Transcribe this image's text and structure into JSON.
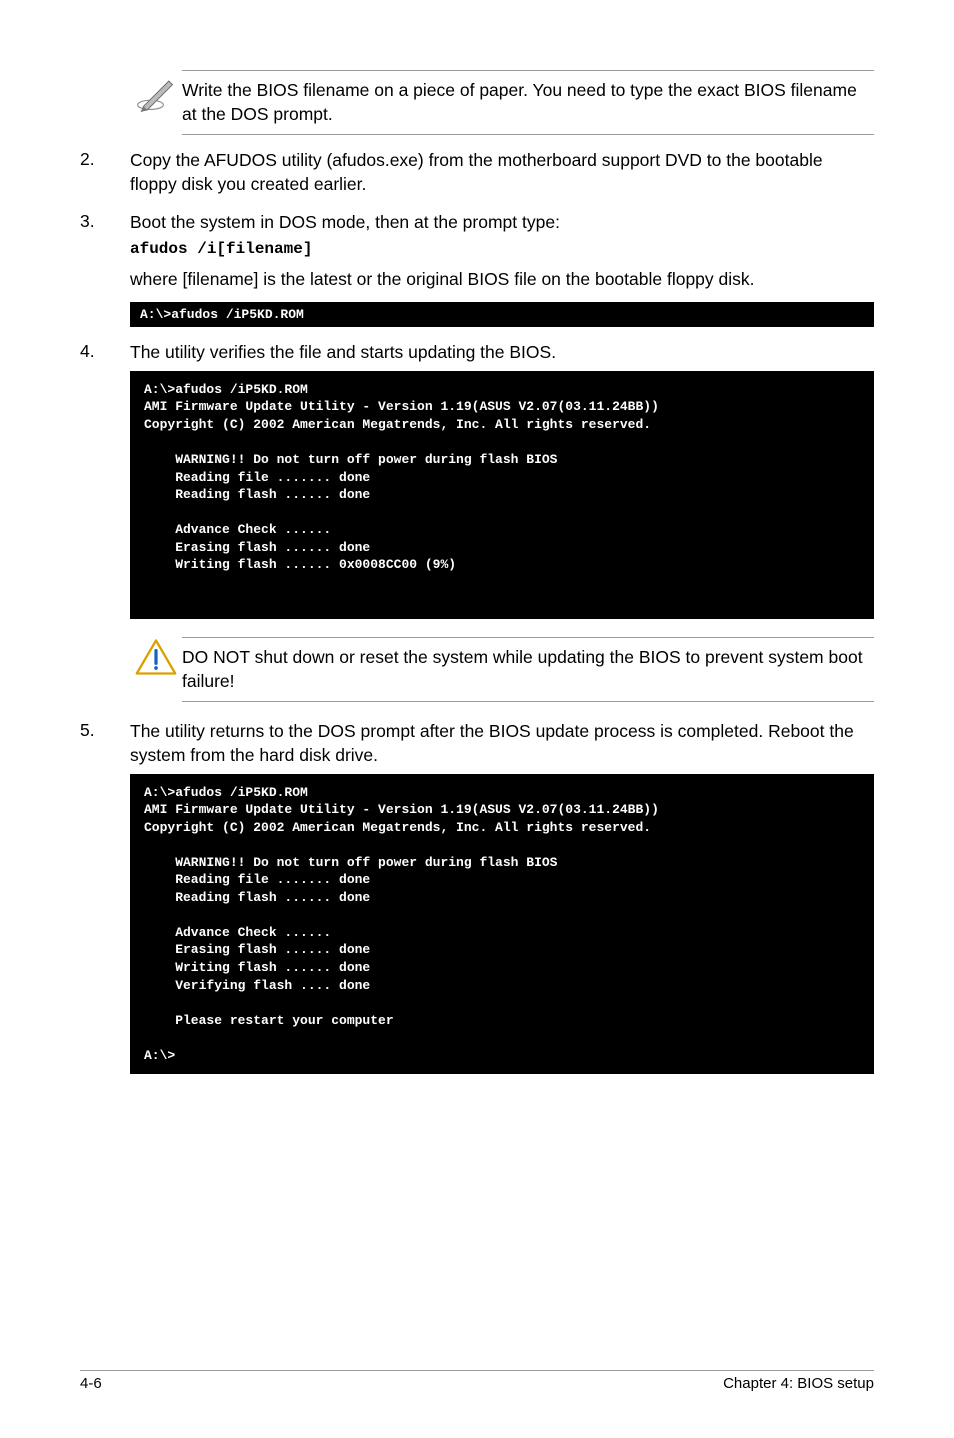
{
  "note": {
    "text": "Write the BIOS filename on a piece of paper. You need to type the exact BIOS filename at the DOS prompt."
  },
  "step2": {
    "num": "2.",
    "text": "Copy the AFUDOS utility (afudos.exe) from the motherboard support DVD to the bootable floppy disk you created earlier."
  },
  "step3": {
    "num": "3.",
    "text": "Boot the system in DOS mode, then at the prompt type:",
    "code": "afudos /i[filename]"
  },
  "paraWhere": "where [filename] is the latest or the original BIOS file on the bootable floppy disk.",
  "term1": "A:\\>afudos /iP5KD.ROM",
  "step4": {
    "num": "4.",
    "text": "The utility verifies the file and starts updating the BIOS."
  },
  "term2": "A:\\>afudos /iP5KD.ROM\nAMI Firmware Update Utility - Version 1.19(ASUS V2.07(03.11.24BB))\nCopyright (C) 2002 American Megatrends, Inc. All rights reserved.\n\n    WARNING!! Do not turn off power during flash BIOS\n    Reading file ....... done\n    Reading flash ...... done\n\n    Advance Check ......\n    Erasing flash ...... done\n    Writing flash ...... 0x0008CC00 (9%)\n\n\n",
  "warn": {
    "text": "DO NOT shut down or reset the system while updating the BIOS to prevent system boot failure!"
  },
  "step5": {
    "num": "5.",
    "text": "The utility returns to the DOS prompt after the BIOS update process is completed. Reboot the system from the hard disk drive."
  },
  "term3": "A:\\>afudos /iP5KD.ROM\nAMI Firmware Update Utility - Version 1.19(ASUS V2.07(03.11.24BB))\nCopyright (C) 2002 American Megatrends, Inc. All rights reserved.\n\n    WARNING!! Do not turn off power during flash BIOS\n    Reading file ....... done\n    Reading flash ...... done\n\n    Advance Check ......\n    Erasing flash ...... done\n    Writing flash ...... done\n    Verifying flash .... done\n\n    Please restart your computer\n\nA:\\>",
  "footer": {
    "left": "4-6",
    "right": "Chapter 4: BIOS setup"
  }
}
